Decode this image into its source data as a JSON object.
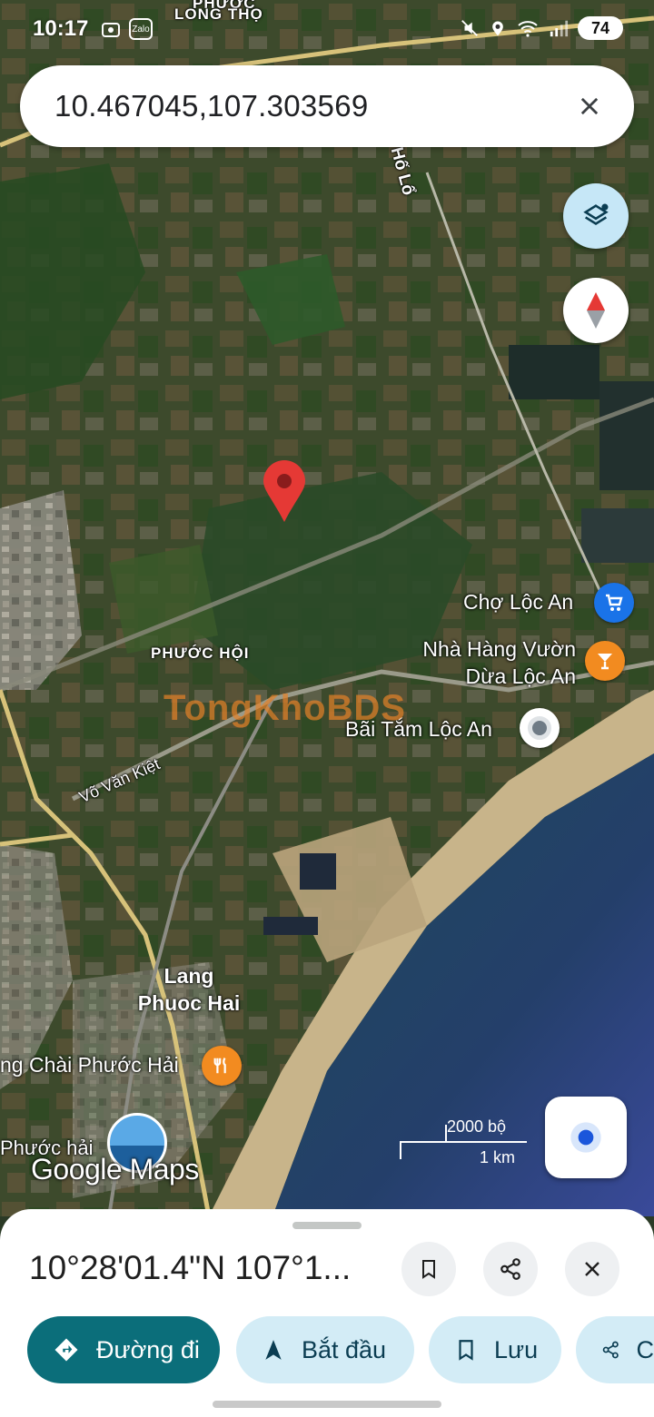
{
  "status_bar": {
    "time": "10:17",
    "left_icons": [
      "screen-record-icon",
      "zalo-icon"
    ],
    "zalo_label": "Zalo",
    "right_icons": [
      "mute-icon",
      "location-icon",
      "wifi-icon",
      "signal-icon"
    ],
    "battery": "74"
  },
  "search": {
    "query": "10.467045,107.303569",
    "clear_icon": "close-icon"
  },
  "map": {
    "labels": {
      "long_tho_top": "PHƯỚC",
      "long_tho": "LONG THỌ",
      "ho_lo": "Hố Lổ",
      "phuoc_hoi": "PHƯỚC HỘI",
      "vo_van_kiet": "Võ Văn Kiệt",
      "lang_phuoc_hai_1": "Lang",
      "lang_phuoc_hai_2": "Phuoc Hai",
      "phuoc_hai": "Phước hải"
    },
    "pois": {
      "cho_loc_an": "Chợ Lộc An",
      "nha_hang_1": "Nhà Hàng Vườn",
      "nha_hang_2": "Dừa Lộc An",
      "bai_tam": "Bãi Tắm Lộc An",
      "lang_chai": "ng Chài Phước Hải"
    },
    "scale": {
      "top": "2000 bộ",
      "bottom": "1 km"
    },
    "watermark_google": "Google Maps",
    "watermark_site": "TongKhoBDS",
    "colors": {
      "pin": "#e53935",
      "shopping_poi": "#1a73e8",
      "food_poi": "#f28b20",
      "sea": "#1f3e5e"
    }
  },
  "sheet": {
    "coordinates": "10°28'01.4\"N 107°1...",
    "actions": [
      {
        "icon": "bookmark-icon"
      },
      {
        "icon": "share-icon"
      },
      {
        "icon": "close-icon"
      }
    ],
    "chips": [
      {
        "label": "Đường đi",
        "icon": "directions-icon"
      },
      {
        "label": "Bắt đầu",
        "icon": "navigation-arrow-icon"
      },
      {
        "label": "Lưu",
        "icon": "bookmark-icon"
      },
      {
        "label": "C",
        "icon": "share-icon"
      }
    ]
  }
}
